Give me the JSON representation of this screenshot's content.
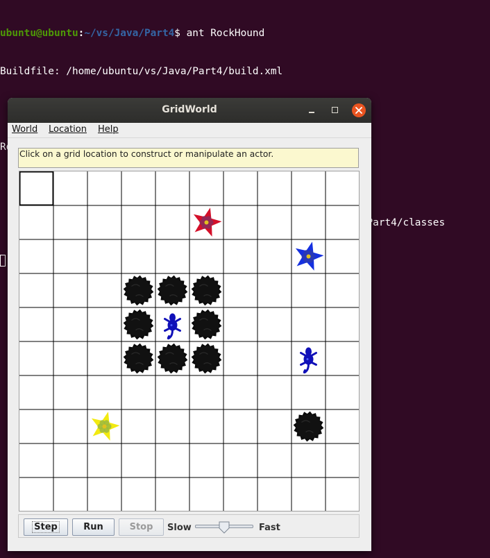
{
  "terminal": {
    "prompt_user": "ubuntu@ubuntu",
    "prompt_path": "~/vs/Java/Part4",
    "prompt_suffix": "$ ",
    "command": "ant RockHound",
    "lines": [
      "Buildfile: /home/ubuntu/vs/Java/Part4/build.xml",
      "",
      "RockHound:",
      "    [mkdir] Created dir: /home/ubuntu/vs/Java/Part4/classes",
      "    [javac] Compiling 2 source files to /home/ubuntu/vs/Java/Part4/classes"
    ]
  },
  "window": {
    "title": "GridWorld"
  },
  "menu": {
    "world": "World",
    "location": "Location",
    "help": "Help"
  },
  "message": "Click on a grid location to construct or manipulate an actor.",
  "grid": {
    "rows": 10,
    "cols": 10,
    "selected": {
      "row": 0,
      "col": 0
    },
    "actors": [
      {
        "type": "flower",
        "row": 1,
        "col": 5,
        "color": "#d4102a",
        "center": "#8a2a5a"
      },
      {
        "type": "flower",
        "row": 2,
        "col": 8,
        "color": "#1530e0",
        "center": "#2a3ab0"
      },
      {
        "type": "rock",
        "row": 3,
        "col": 3
      },
      {
        "type": "rock",
        "row": 3,
        "col": 4
      },
      {
        "type": "rock",
        "row": 3,
        "col": 5
      },
      {
        "type": "rock",
        "row": 4,
        "col": 3
      },
      {
        "type": "critter",
        "row": 4,
        "col": 4,
        "color": "#1010b8"
      },
      {
        "type": "rock",
        "row": 4,
        "col": 5
      },
      {
        "type": "rock",
        "row": 5,
        "col": 3
      },
      {
        "type": "rock",
        "row": 5,
        "col": 4
      },
      {
        "type": "rock",
        "row": 5,
        "col": 5
      },
      {
        "type": "critter",
        "row": 5,
        "col": 8,
        "color": "#1010b8"
      },
      {
        "type": "flower",
        "row": 7,
        "col": 2,
        "color": "#f2ea10",
        "center": "#9cb840"
      },
      {
        "type": "rock",
        "row": 7,
        "col": 8
      }
    ]
  },
  "controls": {
    "step": "Step",
    "run": "Run",
    "stop": "Stop",
    "slow": "Slow",
    "fast": "Fast",
    "speed_fraction": 0.5
  },
  "colors": {
    "terminal_bg": "#300a24",
    "prompt_user": "#4e9a06",
    "prompt_path": "#3465a4",
    "close_button": "#e95420",
    "message_bg": "#fbf8cf"
  }
}
